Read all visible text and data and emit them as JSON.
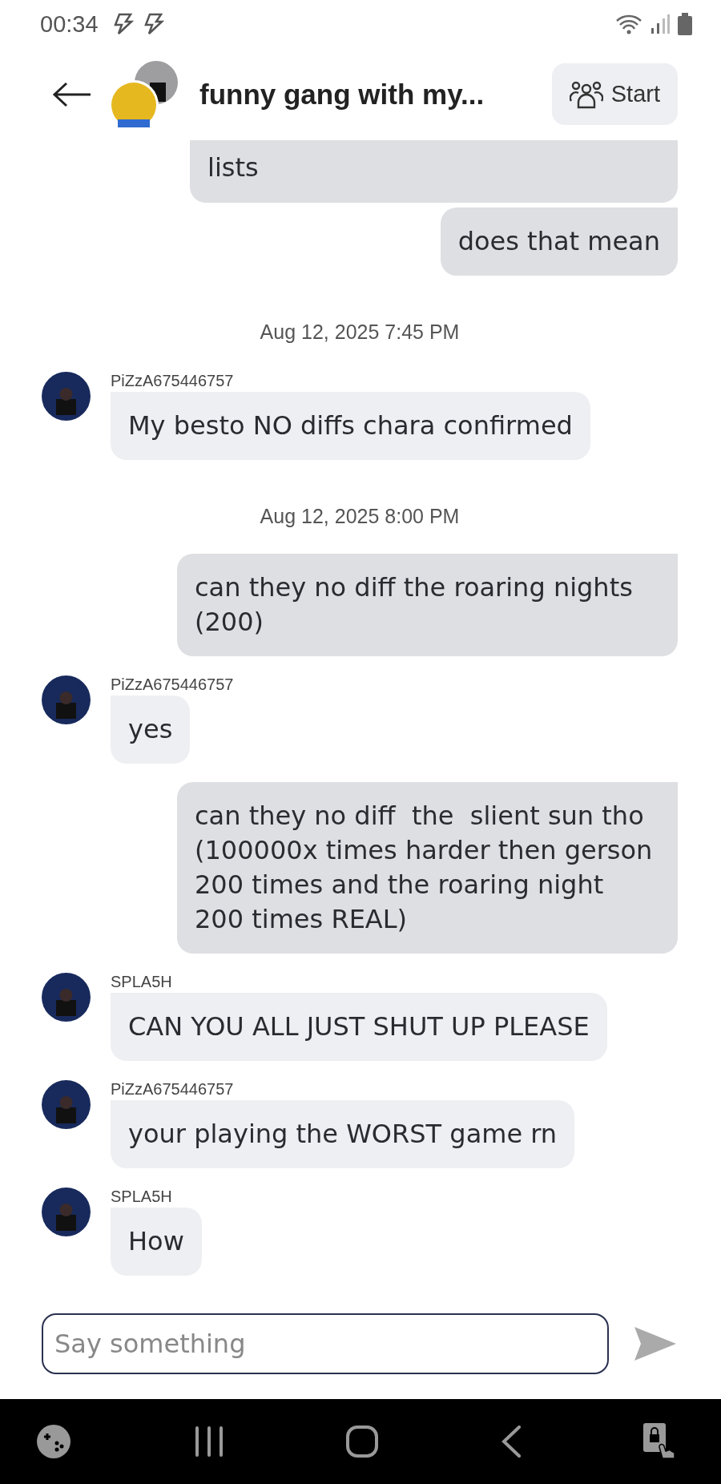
{
  "status_bar": {
    "time": "00:34"
  },
  "header": {
    "title": "funny gang with my...",
    "start_button": "Start"
  },
  "messages": [
    {
      "kind": "outgoing",
      "text": "lists",
      "cut": true
    },
    {
      "kind": "outgoing",
      "text": "does that mean"
    },
    {
      "kind": "timestamp",
      "text": "Aug 12, 2025 7:45 PM"
    },
    {
      "kind": "incoming",
      "sender": "PiZzA675446757",
      "text": "My besto NO diffs chara confirmed"
    },
    {
      "kind": "timestamp",
      "text": "Aug 12, 2025 8:00 PM"
    },
    {
      "kind": "outgoing",
      "text": "can they no diff the roaring nights (200)"
    },
    {
      "kind": "incoming",
      "sender": "PiZzA675446757",
      "text": "yes"
    },
    {
      "kind": "outgoing",
      "text": "can they no diff  the  slient sun tho (100000x times harder then gerson 200 times and the roaring night 200 times REAL)"
    },
    {
      "kind": "incoming",
      "sender": "SPLA5H",
      "text": "CAN YOU ALL JUST SHUT UP PLEASE"
    },
    {
      "kind": "incoming",
      "sender": "PiZzA675446757",
      "text": "your playing the WORST game rn"
    },
    {
      "kind": "incoming",
      "sender": "SPLA5H",
      "text": "How"
    }
  ],
  "composer": {
    "placeholder": "Say something"
  }
}
